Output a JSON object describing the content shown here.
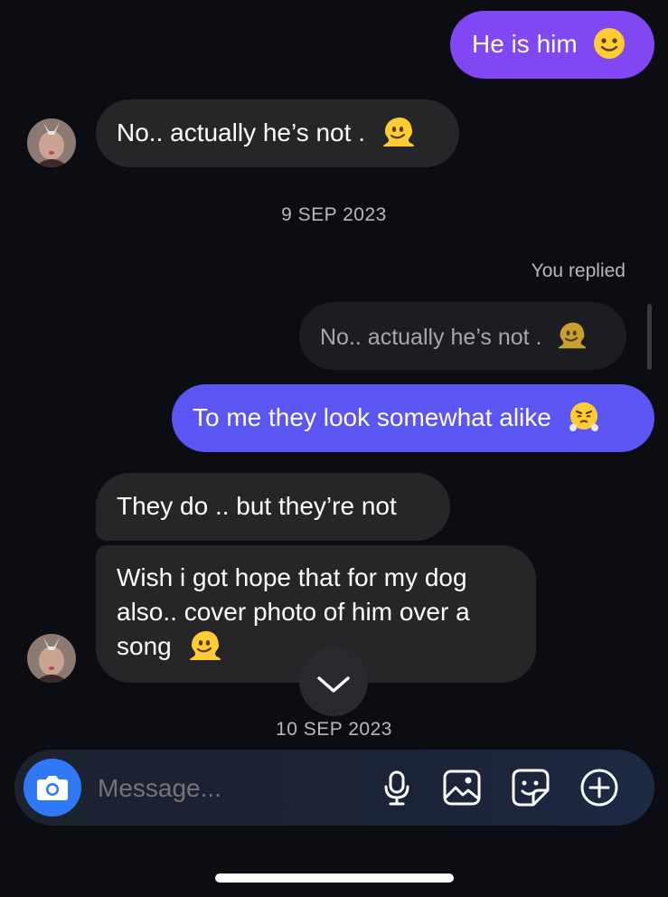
{
  "messages": {
    "m1": {
      "text": "He is him",
      "emoji": "slightly-smiling-face"
    },
    "m2": {
      "text": "No.. actually he’s not .",
      "emoji": "melting-face"
    },
    "date1": "9 SEP 2023",
    "reply_label": "You replied",
    "quoted": {
      "text": "No.. actually he’s not .",
      "emoji": "melting-face"
    },
    "m3": {
      "text": "To me they look somewhat alike",
      "emoji": "face-with-steam-from-nose"
    },
    "m4": {
      "text": "They do .. but they’re not"
    },
    "m5": {
      "line1": "Wish i got hope that for my dog",
      "line2": "also.. cover photo of him over a",
      "line3": "song",
      "emoji": "melting-face"
    },
    "date2": "10 SEP 2023"
  },
  "composer": {
    "placeholder": "Message...",
    "icons": [
      "camera-icon",
      "microphone-icon",
      "gallery-icon",
      "sticker-icon",
      "plus-icon"
    ]
  },
  "colors": {
    "background": "#0b0d12",
    "outgoing_purple": "#8147f5",
    "outgoing_blue": "#5a55f3",
    "incoming": "#262629",
    "camera_button": "#2f79f6"
  }
}
